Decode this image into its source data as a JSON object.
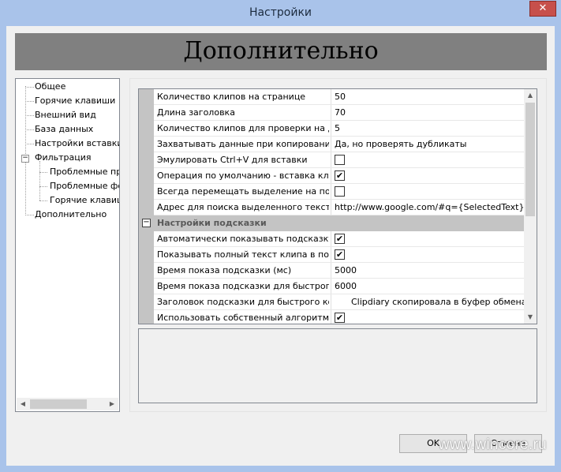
{
  "window": {
    "title": "Настройки",
    "close_glyph": "✕"
  },
  "header": {
    "title": "Дополнительно"
  },
  "tree": {
    "items": [
      {
        "label": "Общее"
      },
      {
        "label": "Горячие клавиши"
      },
      {
        "label": "Внешний вид"
      },
      {
        "label": "База данных"
      },
      {
        "label": "Настройки вставки"
      },
      {
        "label": "Фильтрация",
        "expander": "−"
      },
      {
        "label": "Проблемные пр"
      },
      {
        "label": "Проблемные фо"
      },
      {
        "label": "Горячие клавиш"
      },
      {
        "label": "Дополнительно"
      }
    ],
    "scroll_left": "◀",
    "scroll_right": "▶"
  },
  "grid": {
    "rows_top": [
      {
        "name": "Количество клипов на странице",
        "value": "50"
      },
      {
        "name": "Длина заголовка",
        "value": "70"
      },
      {
        "name": "Количество клипов для проверки на дубликаты",
        "value": "5"
      },
      {
        "name": "Захватывать данные при копировании к",
        "value": "Да, но проверять дубликаты"
      },
      {
        "name": "Эмулировать Ctrl+V для вставки",
        "checked": false
      },
      {
        "name": "Операция по умолчанию - вставка клип",
        "checked": true
      },
      {
        "name": "Всегда перемещать выделение на после",
        "checked": false
      },
      {
        "name": "Адрес для поиска выделенного текста в",
        "value": "http://www.google.com/#q={SelectedText}"
      }
    ],
    "category": {
      "toggle": "−",
      "label": "Настройки подсказки"
    },
    "rows_bottom": [
      {
        "name": "Автоматически показывать подсказку п",
        "checked": true
      },
      {
        "name": "Показывать полный текст клипа в подск",
        "checked": true
      },
      {
        "name": "Время показа подсказки (мс)",
        "value": "5000"
      },
      {
        "name": "Время показа подсказки для быстрого к",
        "value": "6000"
      },
      {
        "name": "Заголовок подсказки для быстрого копи",
        "value": "Clipdiary скопировала в буфер обмена"
      },
      {
        "name": "Использовать собственный алгоритм д",
        "checked": true
      }
    ],
    "check_glyph": "✔",
    "scroll_up": "▲",
    "scroll_down": "▼"
  },
  "buttons": {
    "ok": "OK",
    "cancel": "Отмена"
  },
  "watermark": "www.wincore.ru"
}
